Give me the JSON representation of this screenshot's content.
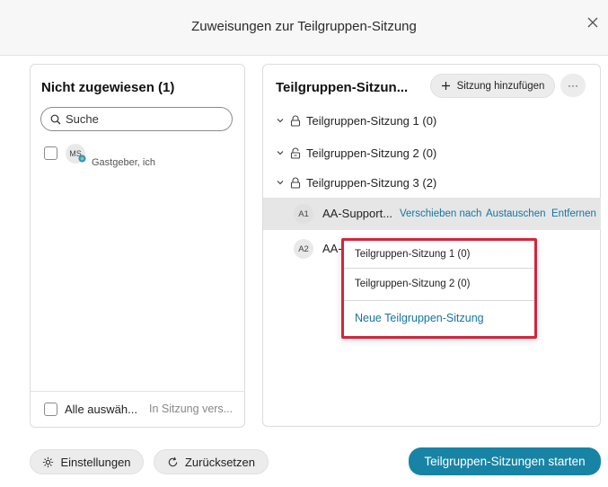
{
  "dialog": {
    "title": "Zuweisungen zur Teilgruppen-Sitzung",
    "close_symbol": "×"
  },
  "left_panel": {
    "title": "Nicht zugewiesen (1)",
    "search_placeholder": "Suche",
    "participant": {
      "initials": "MS",
      "role": "Gastgeber, ich"
    },
    "select_all_label": "Alle auswäh...",
    "move_label": "In Sitzung vers..."
  },
  "right_panel": {
    "title": "Teilgruppen-Sitzun...",
    "add_session_label": "Sitzung hinzufügen",
    "more_label": "···",
    "sessions": [
      {
        "label": "Teilgruppen-Sitzung 1 (0)"
      },
      {
        "label": "Teilgruppen-Sitzung 2 (0)"
      },
      {
        "label": "Teilgruppen-Sitzung 3 (2)"
      }
    ],
    "participants": [
      {
        "initials": "A1",
        "name": "AA-Support..."
      },
      {
        "initials": "A2",
        "name": "AA-"
      }
    ],
    "actions": {
      "move_to": "Verschieben nach",
      "exchange": "Austauschen",
      "remove": "Entfernen"
    }
  },
  "dropdown": {
    "items": [
      "Teilgruppen-Sitzung 1 (0)",
      "Teilgruppen-Sitzung 2 (0)"
    ],
    "new_session": "Neue Teilgruppen-Sitzung"
  },
  "footer": {
    "settings_label": "Einstellungen",
    "reset_label": "Zurücksetzen",
    "start_label": "Teilgruppen-Sitzungen starten"
  },
  "colors": {
    "accent": "#1784a6",
    "link": "#1575a4",
    "highlight_border": "#d6243a"
  }
}
